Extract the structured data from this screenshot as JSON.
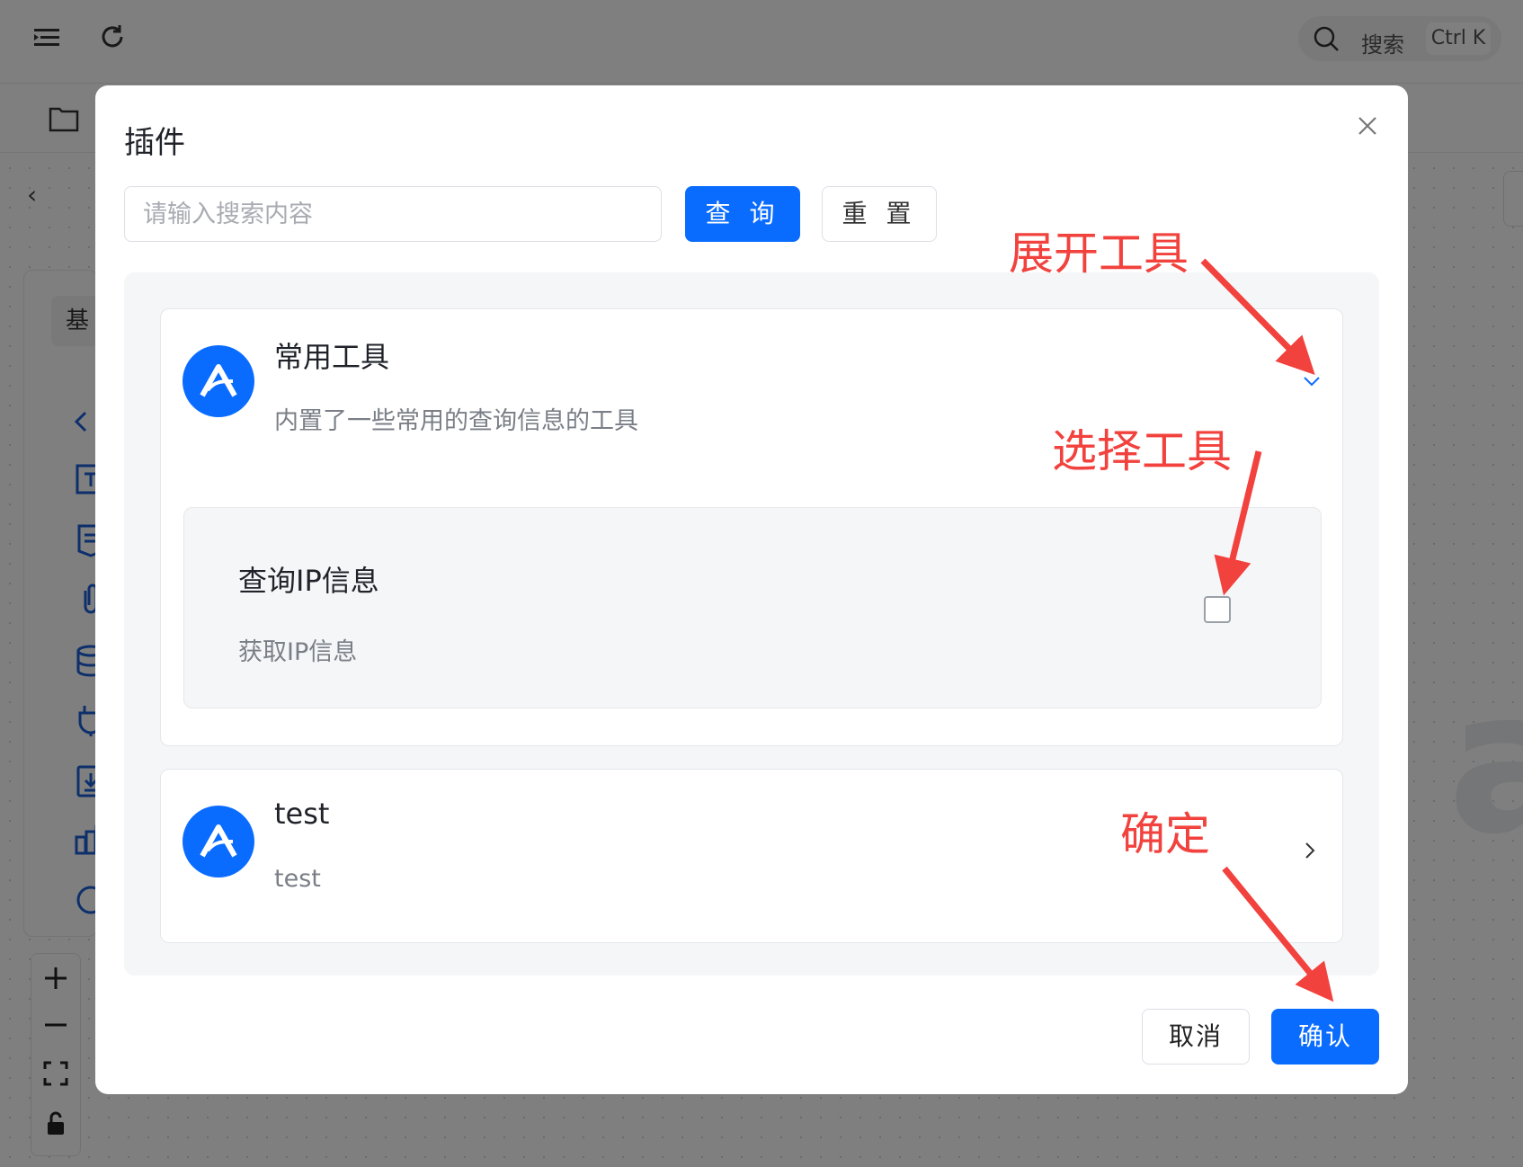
{
  "app": {
    "search": {
      "label": "搜索",
      "shortcut": "Ctrl K"
    },
    "left_tab": "基"
  },
  "dialog": {
    "title": "插件",
    "search": {
      "placeholder": "请输入搜索内容",
      "value": ""
    },
    "query_label": "查 询",
    "reset_label": "重 置",
    "plugins": [
      {
        "name": "常用工具",
        "description": "内置了一些常用的查询信息的工具",
        "expanded": true,
        "tools": [
          {
            "name": "查询IP信息",
            "description": "获取IP信息",
            "checked": false
          }
        ]
      },
      {
        "name": "test",
        "description": "test",
        "expanded": false
      }
    ],
    "cancel_label": "取消",
    "confirm_label": "确认"
  },
  "annotations": {
    "expand": "展开工具",
    "select": "选择工具",
    "confirm": "确定",
    "color": "#f2423e"
  },
  "colors": {
    "primary": "#0a6cff",
    "annotation": "#f2423e"
  }
}
